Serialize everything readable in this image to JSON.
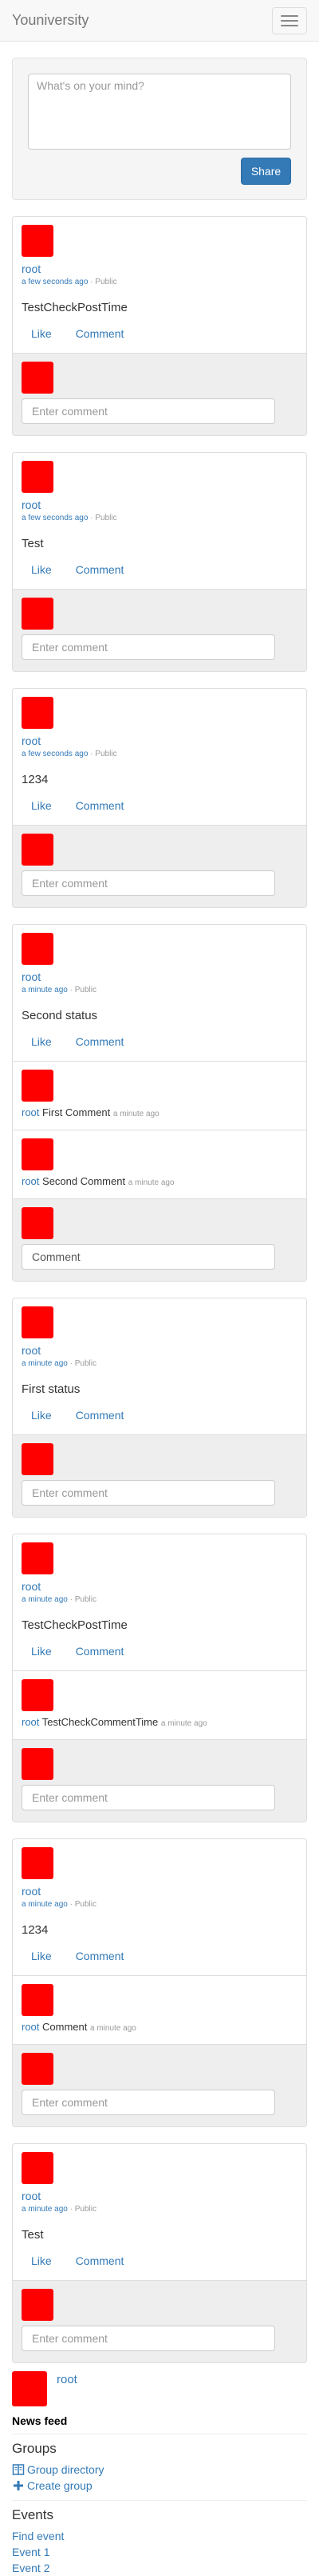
{
  "navbar": {
    "brand": "Youniversity",
    "menu_icon": "hamburger-icon"
  },
  "share_box": {
    "placeholder": "What's on your mind?",
    "button_label": "Share"
  },
  "posts": [
    {
      "author": "root",
      "time": "a few seconds ago",
      "separator": "·",
      "audience": "Public",
      "status": "TestCheckPostTime",
      "like_label": "Like",
      "comment_label": "Comment",
      "comments": [],
      "form": {
        "value": "",
        "placeholder": "Enter comment"
      }
    },
    {
      "author": "root",
      "time": "a few seconds ago",
      "separator": "·",
      "audience": "Public",
      "status": "Test",
      "like_label": "Like",
      "comment_label": "Comment",
      "comments": [],
      "form": {
        "value": "",
        "placeholder": "Enter comment"
      }
    },
    {
      "author": "root",
      "time": "a few seconds ago",
      "separator": "·",
      "audience": "Public",
      "status": "1234",
      "like_label": "Like",
      "comment_label": "Comment",
      "comments": [],
      "form": {
        "value": "",
        "placeholder": "Enter comment"
      }
    },
    {
      "author": "root",
      "time": "a minute ago",
      "separator": "·",
      "audience": "Public",
      "status": "Second status",
      "like_label": "Like",
      "comment_label": "Comment",
      "comments": [
        {
          "author": "root",
          "text": "First Comment",
          "time": "a minute ago"
        },
        {
          "author": "root",
          "text": "Second Comment",
          "time": "a minute ago"
        }
      ],
      "form": {
        "value": "Comment",
        "placeholder": "Enter comment"
      }
    },
    {
      "author": "root",
      "time": "a minute ago",
      "separator": "·",
      "audience": "Public",
      "status": "First status",
      "like_label": "Like",
      "comment_label": "Comment",
      "comments": [],
      "form": {
        "value": "",
        "placeholder": "Enter comment"
      }
    },
    {
      "author": "root",
      "time": "a minute ago",
      "separator": "·",
      "audience": "Public",
      "status": "TestCheckPostTime",
      "like_label": "Like",
      "comment_label": "Comment",
      "comments": [
        {
          "author": "root",
          "text": "TestCheckCommentTime",
          "time": "a minute ago"
        }
      ],
      "form": {
        "value": "",
        "placeholder": "Enter comment"
      }
    },
    {
      "author": "root",
      "time": "a minute ago",
      "separator": "·",
      "audience": "Public",
      "status": "1234",
      "like_label": "Like",
      "comment_label": "Comment",
      "comments": [
        {
          "author": "root",
          "text": "Comment",
          "time": "a minute ago"
        }
      ],
      "form": {
        "value": "",
        "placeholder": "Enter comment"
      }
    },
    {
      "author": "root",
      "time": "a minute ago",
      "separator": "·",
      "audience": "Public",
      "status": "Test",
      "like_label": "Like",
      "comment_label": "Comment",
      "comments": [],
      "form": {
        "value": "",
        "placeholder": "Enter comment"
      }
    }
  ],
  "sidebar": {
    "profile_name": "root",
    "news_feed": "News feed",
    "groups_heading": "Groups",
    "group_links": [
      {
        "label": "Group directory",
        "icon": "book-icon"
      },
      {
        "label": "Create group",
        "icon": "plus-icon"
      }
    ],
    "events_heading": "Events",
    "event_links": [
      {
        "label": "Find event"
      },
      {
        "label": "Event 1"
      },
      {
        "label": "Event 2"
      }
    ]
  },
  "colors": {
    "brand_blue": "#337ab7",
    "avatar_red": "#ff0000",
    "comment_form_bg": "#eeeeee",
    "share_box_bg": "#f5f5f5"
  }
}
